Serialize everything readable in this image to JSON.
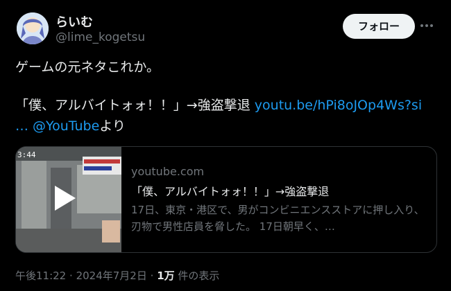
{
  "user": {
    "display_name": "らいむ",
    "handle": "@lime_kogetsu",
    "follow_label": "フォロー"
  },
  "tweet": {
    "line1": "ゲームの元ネタこれか。",
    "line2_text": "「僕、アルバイトォォ！！」→強盗撃退 ",
    "line2_link": "youtu.be/hPi8oJOp4Ws?si",
    "line3_link": "… @YouTube",
    "line3_text": "より"
  },
  "card": {
    "domain": "youtube.com",
    "title": "「僕、アルバイトォォ！！」→強盗撃退",
    "description": "17日、東京・港区で、男がコンビニエンスストアに押し入り、刃物で男性店員を脅した。 17日朝早く、…"
  },
  "meta": {
    "time": "午後11:22",
    "separator": "·",
    "date": "2024年7月2日",
    "views_count": "1万",
    "views_label": "件の表示"
  },
  "colors": {
    "link": "#1d9bf0",
    "secondary_text": "#71767b",
    "background": "#000000"
  }
}
